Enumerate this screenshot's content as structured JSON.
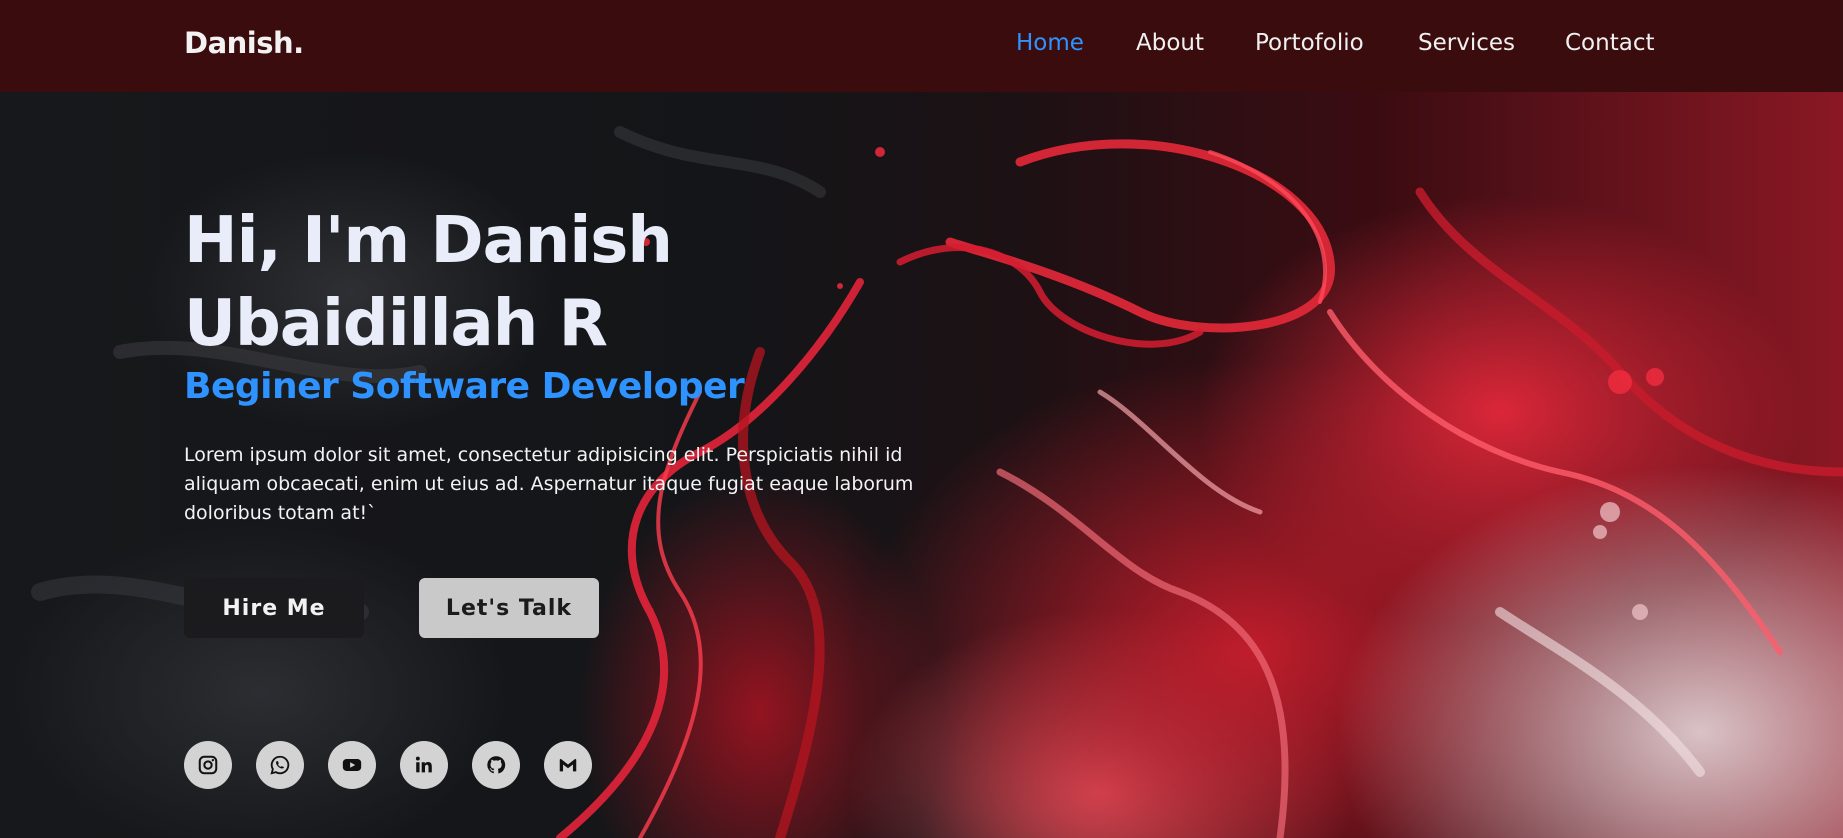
{
  "header": {
    "logo": "Danish.",
    "nav": [
      {
        "label": "Home",
        "active": true
      },
      {
        "label": "About",
        "active": false
      },
      {
        "label": "Portofolio",
        "active": false
      },
      {
        "label": "Services",
        "active": false
      },
      {
        "label": "Contact",
        "active": false
      }
    ]
  },
  "hero": {
    "title_line1": "Hi, I'm Danish",
    "title_line2": "Ubaidillah R",
    "subtitle": "Beginer Software Developer",
    "description": "Lorem ipsum dolor sit amet, consectetur adipisicing elit. Perspiciatis nihil id aliquam obcaecati, enim ut eius ad. Aspernatur itaque fugiat eaque laborum doloribus totam at!`",
    "buttons": {
      "primary": "Hire Me",
      "secondary": "Let's Talk"
    },
    "socials": [
      "instagram-icon",
      "whatsapp-icon",
      "youtube-icon",
      "linkedin-icon",
      "github-icon",
      "gmail-icon"
    ]
  },
  "colors": {
    "header_bg": "#3a0c0e",
    "accent": "#2f93ff",
    "title": "#e9ecf9",
    "primary_button": "#1b1b1d",
    "secondary_button": "#c9c9c9",
    "social_bg": "#d3d3d3"
  }
}
